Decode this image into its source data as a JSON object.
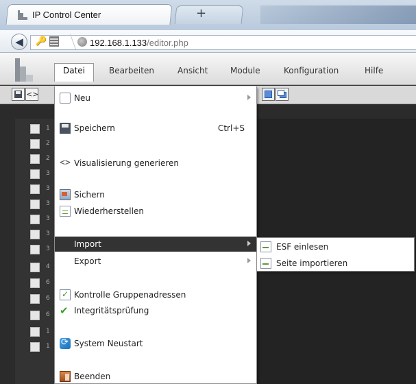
{
  "browser": {
    "tab_title": "IP Control Center",
    "new_tab_symbol": "+",
    "url_host": "192.168.1.133",
    "url_path": "/editor.php"
  },
  "app": {
    "menu": [
      {
        "label": "Datei",
        "active": true
      },
      {
        "label": "Bearbeiten"
      },
      {
        "label": "Ansicht"
      },
      {
        "label": "Module"
      },
      {
        "label": "Konfiguration"
      },
      {
        "label": "Hilfe"
      }
    ]
  },
  "sidebar": {
    "rows": [
      "1",
      "2",
      "2",
      "3",
      "3",
      "3",
      "3",
      "3",
      "3",
      "4",
      "6",
      "6",
      "6",
      "1",
      "1"
    ]
  },
  "dropdown": {
    "items": [
      {
        "label": "Neu",
        "icon": "new-page-icon"
      },
      {
        "label": "Speichern",
        "shortcut": "Ctrl+S",
        "icon": "save-disk-icon"
      },
      {
        "label": "Visualisierung generieren",
        "icon": "code-icon"
      },
      {
        "label": "Sichern",
        "icon": "backup-icon"
      },
      {
        "label": "Wiederherstellen",
        "icon": "restore-icon"
      },
      {
        "label": "Import",
        "highlighted": true,
        "has_submenu": true
      },
      {
        "label": "Export",
        "has_submenu": true
      },
      {
        "label": "Kontrolle Gruppenadressen",
        "icon": "checklist-icon"
      },
      {
        "label": "Integritätsprüfung",
        "icon": "checkmark-icon"
      },
      {
        "label": "System Neustart",
        "icon": "system-restart-icon"
      },
      {
        "label": "Beenden",
        "icon": "exit-door-icon"
      }
    ]
  },
  "submenu": {
    "items": [
      {
        "label": "ESF einlesen",
        "icon": "import-page-icon"
      },
      {
        "label": "Seite importieren",
        "icon": "import-page-icon"
      }
    ]
  },
  "colors": {
    "menu_highlight": "#333333",
    "workspace_bg": "#232323"
  }
}
